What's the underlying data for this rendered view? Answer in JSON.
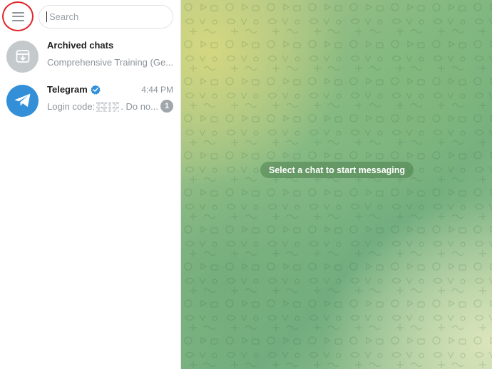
{
  "sidebar": {
    "search": {
      "placeholder": "Search",
      "value": ""
    },
    "chats": [
      {
        "title": "Archived chats",
        "preview": "Comprehensive Training (Ge...",
        "icon": "archive-icon"
      },
      {
        "title": "Telegram",
        "verified": true,
        "time": "4:44 PM",
        "preview_start": "Login code:",
        "preview_end": ". Do no...",
        "unread": "1",
        "icon": "telegram-paper-plane-icon"
      }
    ]
  },
  "main": {
    "empty_message": "Select a chat to start messaging"
  },
  "colors": {
    "accent": "#3390d8",
    "highlight_circle": "#e0262b",
    "badge": "#a1a6ab"
  }
}
